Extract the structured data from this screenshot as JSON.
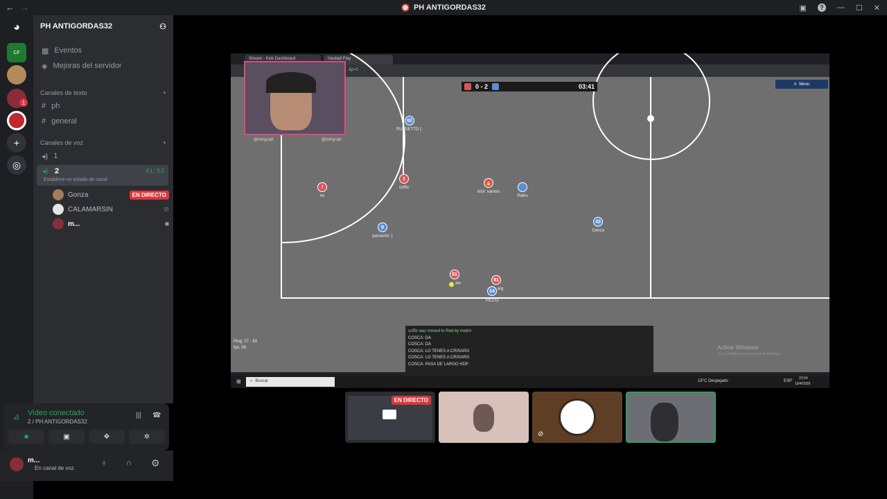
{
  "window": {
    "title": "PH ANTIGORDAS32"
  },
  "server": {
    "name": "PH ANTIGORDAS32",
    "events": "Eventos",
    "boosts": "Mejoras del servidor",
    "text_category": "Canales de texto",
    "text_channels": [
      "ph",
      "general"
    ],
    "voice_category": "Canales de voz",
    "voice_channels": [
      {
        "name": "1"
      },
      {
        "name": "2",
        "timer": "41:52",
        "status": "Establece un estado de canal"
      }
    ],
    "voice_users": [
      {
        "name": "Gonza",
        "badge": "EN DIRECTO"
      },
      {
        "name": "CALAMARSIN"
      },
      {
        "name": "m..."
      }
    ]
  },
  "server_badge": "1",
  "voice_panel": {
    "status": "Video conectado",
    "location": "2 / PH ANTIGORDAS32"
  },
  "user": {
    "name": "m...",
    "status": "En canal de voz"
  },
  "stream": {
    "browser_tabs": [
      "Stream - Kick Dashboard",
      "Haxball Play"
    ],
    "url": "&p=1",
    "score": "0 - 2",
    "time": "03:41",
    "menu_label": "Menu",
    "webcam_handles": [
      "@mirtycah",
      "@mirtycah"
    ],
    "players": [
      {
        "num": "92",
        "name": "PUSSETTO (:",
        "team": "blue"
      },
      {
        "num": "1",
        "name": "coffix",
        "team": "red"
      },
      {
        "num": "!",
        "name": "nx",
        "team": "red"
      },
      {
        "num": "🔥",
        "name": "kick: santoo",
        "team": "red"
      },
      {
        "num": "",
        "name": "Piahu",
        "team": "blue"
      },
      {
        "num": "43",
        "name": "Gonza",
        "team": "blue"
      },
      {
        "num": "9",
        "name": "passerini :)",
        "team": "blue"
      },
      {
        "num": "51",
        "name": "aw",
        "team": "red"
      },
      {
        "num": "91",
        "name": "arg",
        "team": "red"
      },
      {
        "num": "14",
        "name": "PICCO",
        "team": "blue"
      }
    ],
    "chat": [
      "coffix was moved to Red by matini",
      "COSCA: DA",
      "COSCA: DA",
      "COSCA: LO TENES A CRISARG",
      "COSCA: LO TENES A CRISARG",
      "COSCA: PASA DE LARGO HDP"
    ],
    "ping": "Ping: 27 - 63",
    "fps": "fps: 59",
    "activate_title": "Activar Windows",
    "activate_sub": "Ve a Configuración para activar Windows.",
    "taskbar_search": "Buscar",
    "weather": "15°C Despejado",
    "lang": "ESP",
    "clock_time": "23:54",
    "clock_date": "10/4/2026"
  },
  "tiles": {
    "live_badge": "EN DIRECTO"
  },
  "colors": {
    "accent_green": "#23a55a",
    "live_red": "#da373c",
    "discord_bg": "#2b2d31"
  }
}
